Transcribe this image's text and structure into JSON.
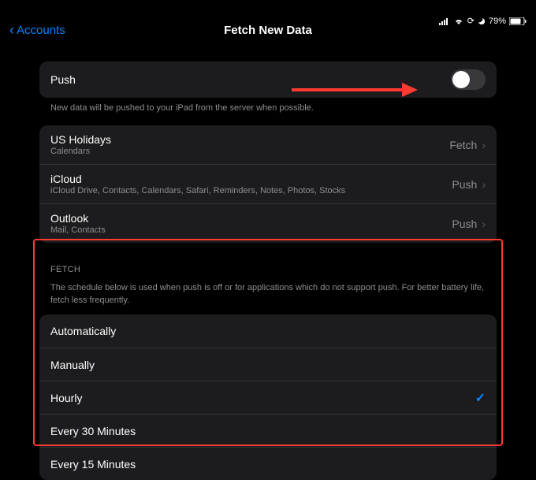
{
  "status": {
    "battery_pct": "79%"
  },
  "nav": {
    "back_label": "Accounts",
    "title": "Fetch New Data"
  },
  "push": {
    "label": "Push",
    "caption": "New data will be pushed to your iPad from the server when possible."
  },
  "accounts": [
    {
      "title": "US Holidays",
      "subtitle": "Calendars",
      "mode": "Fetch"
    },
    {
      "title": "iCloud",
      "subtitle": "iCloud Drive, Contacts, Calendars, Safari, Reminders, Notes, Photos, Stocks",
      "mode": "Push"
    },
    {
      "title": "Outlook",
      "subtitle": "Mail, Contacts",
      "mode": "Push"
    }
  ],
  "fetch": {
    "header": "FETCH",
    "description": "The schedule below is used when push is off or for applications which do not support push. For better battery life, fetch less frequently.",
    "options": [
      {
        "label": "Automatically",
        "selected": false
      },
      {
        "label": "Manually",
        "selected": false
      },
      {
        "label": "Hourly",
        "selected": true
      },
      {
        "label": "Every 30 Minutes",
        "selected": false
      },
      {
        "label": "Every 15 Minutes",
        "selected": false
      }
    ]
  },
  "annotation": {
    "arrow_color": "#ff3b30"
  }
}
